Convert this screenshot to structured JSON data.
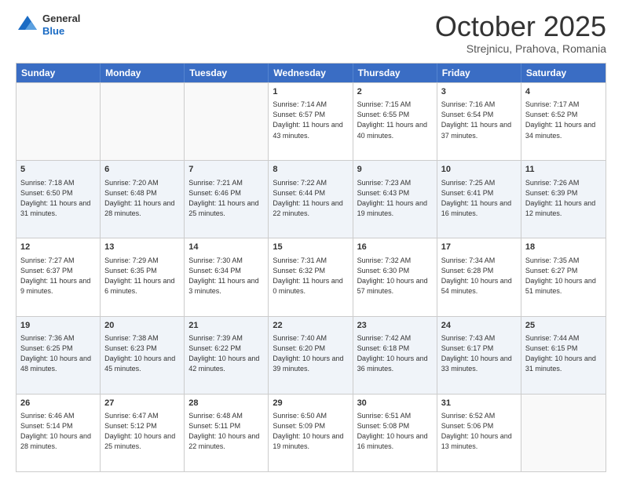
{
  "header": {
    "logo": {
      "general": "General",
      "blue": "Blue"
    },
    "title": "October 2025",
    "location": "Strejnicu, Prahova, Romania"
  },
  "days_of_week": [
    "Sunday",
    "Monday",
    "Tuesday",
    "Wednesday",
    "Thursday",
    "Friday",
    "Saturday"
  ],
  "weeks": [
    [
      {
        "day": "",
        "info": ""
      },
      {
        "day": "",
        "info": ""
      },
      {
        "day": "",
        "info": ""
      },
      {
        "day": "1",
        "info": "Sunrise: 7:14 AM\nSunset: 6:57 PM\nDaylight: 11 hours and 43 minutes."
      },
      {
        "day": "2",
        "info": "Sunrise: 7:15 AM\nSunset: 6:55 PM\nDaylight: 11 hours and 40 minutes."
      },
      {
        "day": "3",
        "info": "Sunrise: 7:16 AM\nSunset: 6:54 PM\nDaylight: 11 hours and 37 minutes."
      },
      {
        "day": "4",
        "info": "Sunrise: 7:17 AM\nSunset: 6:52 PM\nDaylight: 11 hours and 34 minutes."
      }
    ],
    [
      {
        "day": "5",
        "info": "Sunrise: 7:18 AM\nSunset: 6:50 PM\nDaylight: 11 hours and 31 minutes."
      },
      {
        "day": "6",
        "info": "Sunrise: 7:20 AM\nSunset: 6:48 PM\nDaylight: 11 hours and 28 minutes."
      },
      {
        "day": "7",
        "info": "Sunrise: 7:21 AM\nSunset: 6:46 PM\nDaylight: 11 hours and 25 minutes."
      },
      {
        "day": "8",
        "info": "Sunrise: 7:22 AM\nSunset: 6:44 PM\nDaylight: 11 hours and 22 minutes."
      },
      {
        "day": "9",
        "info": "Sunrise: 7:23 AM\nSunset: 6:43 PM\nDaylight: 11 hours and 19 minutes."
      },
      {
        "day": "10",
        "info": "Sunrise: 7:25 AM\nSunset: 6:41 PM\nDaylight: 11 hours and 16 minutes."
      },
      {
        "day": "11",
        "info": "Sunrise: 7:26 AM\nSunset: 6:39 PM\nDaylight: 11 hours and 12 minutes."
      }
    ],
    [
      {
        "day": "12",
        "info": "Sunrise: 7:27 AM\nSunset: 6:37 PM\nDaylight: 11 hours and 9 minutes."
      },
      {
        "day": "13",
        "info": "Sunrise: 7:29 AM\nSunset: 6:35 PM\nDaylight: 11 hours and 6 minutes."
      },
      {
        "day": "14",
        "info": "Sunrise: 7:30 AM\nSunset: 6:34 PM\nDaylight: 11 hours and 3 minutes."
      },
      {
        "day": "15",
        "info": "Sunrise: 7:31 AM\nSunset: 6:32 PM\nDaylight: 11 hours and 0 minutes."
      },
      {
        "day": "16",
        "info": "Sunrise: 7:32 AM\nSunset: 6:30 PM\nDaylight: 10 hours and 57 minutes."
      },
      {
        "day": "17",
        "info": "Sunrise: 7:34 AM\nSunset: 6:28 PM\nDaylight: 10 hours and 54 minutes."
      },
      {
        "day": "18",
        "info": "Sunrise: 7:35 AM\nSunset: 6:27 PM\nDaylight: 10 hours and 51 minutes."
      }
    ],
    [
      {
        "day": "19",
        "info": "Sunrise: 7:36 AM\nSunset: 6:25 PM\nDaylight: 10 hours and 48 minutes."
      },
      {
        "day": "20",
        "info": "Sunrise: 7:38 AM\nSunset: 6:23 PM\nDaylight: 10 hours and 45 minutes."
      },
      {
        "day": "21",
        "info": "Sunrise: 7:39 AM\nSunset: 6:22 PM\nDaylight: 10 hours and 42 minutes."
      },
      {
        "day": "22",
        "info": "Sunrise: 7:40 AM\nSunset: 6:20 PM\nDaylight: 10 hours and 39 minutes."
      },
      {
        "day": "23",
        "info": "Sunrise: 7:42 AM\nSunset: 6:18 PM\nDaylight: 10 hours and 36 minutes."
      },
      {
        "day": "24",
        "info": "Sunrise: 7:43 AM\nSunset: 6:17 PM\nDaylight: 10 hours and 33 minutes."
      },
      {
        "day": "25",
        "info": "Sunrise: 7:44 AM\nSunset: 6:15 PM\nDaylight: 10 hours and 31 minutes."
      }
    ],
    [
      {
        "day": "26",
        "info": "Sunrise: 6:46 AM\nSunset: 5:14 PM\nDaylight: 10 hours and 28 minutes."
      },
      {
        "day": "27",
        "info": "Sunrise: 6:47 AM\nSunset: 5:12 PM\nDaylight: 10 hours and 25 minutes."
      },
      {
        "day": "28",
        "info": "Sunrise: 6:48 AM\nSunset: 5:11 PM\nDaylight: 10 hours and 22 minutes."
      },
      {
        "day": "29",
        "info": "Sunrise: 6:50 AM\nSunset: 5:09 PM\nDaylight: 10 hours and 19 minutes."
      },
      {
        "day": "30",
        "info": "Sunrise: 6:51 AM\nSunset: 5:08 PM\nDaylight: 10 hours and 16 minutes."
      },
      {
        "day": "31",
        "info": "Sunrise: 6:52 AM\nSunset: 5:06 PM\nDaylight: 10 hours and 13 minutes."
      },
      {
        "day": "",
        "info": ""
      }
    ]
  ]
}
